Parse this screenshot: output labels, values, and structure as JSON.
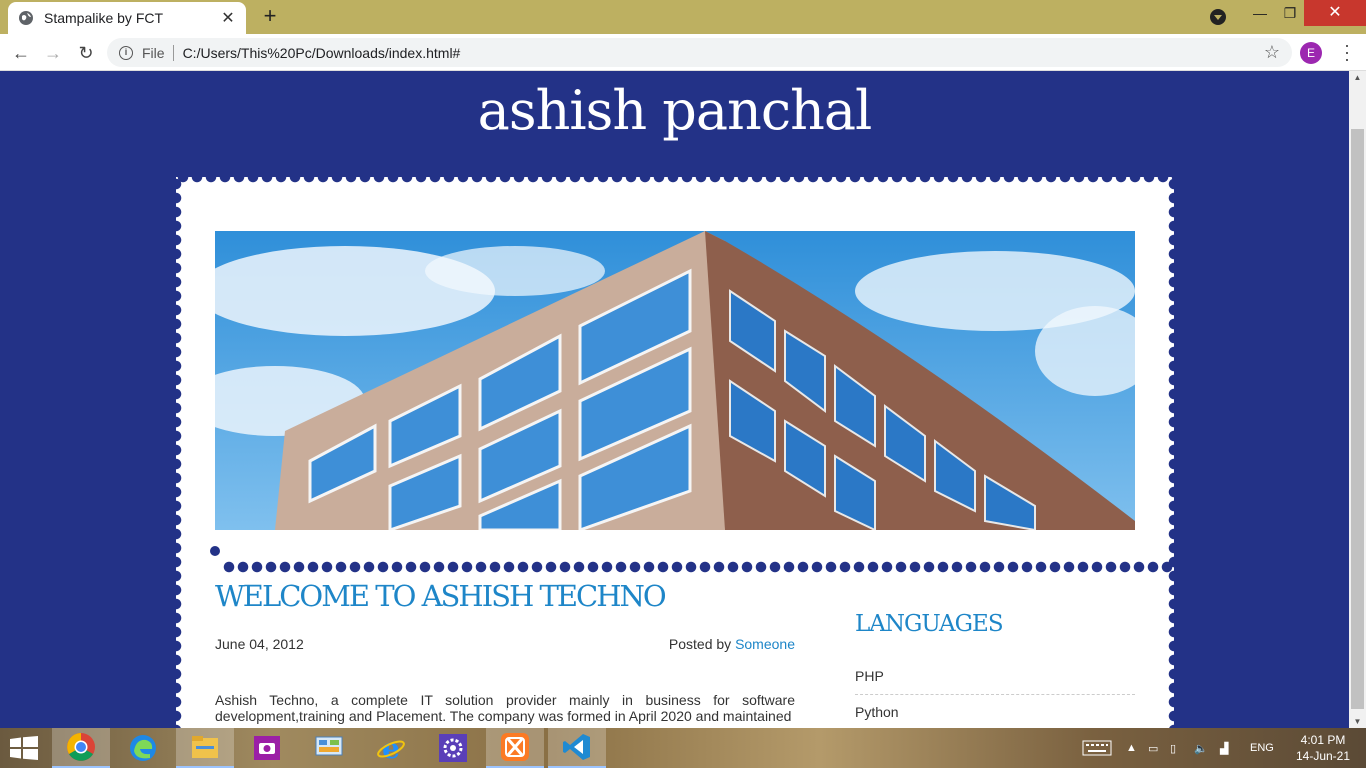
{
  "browser": {
    "tab_title": "Stampalike by FCT",
    "tab_close": "✕",
    "new_tab": "+",
    "file_label": "File",
    "url": "C:/Users/This%20Pc/Downloads/index.html#",
    "profile_initial": "E"
  },
  "window_controls": {
    "minimize": "—",
    "maximize": "❐",
    "close": "✕"
  },
  "site": {
    "title": "ashish panchal",
    "post": {
      "title": "WELCOME TO ASHISH TECHNO",
      "date": "June 04, 2012",
      "posted_by_label": "Posted by",
      "author": "Someone",
      "body": "Ashish Techno, a complete IT solution provider mainly in business for software development,training and Placement. The company was formed in April 2020 and maintained"
    },
    "sidebar": {
      "title": "LANGUAGES",
      "items": [
        {
          "label": "PHP"
        },
        {
          "label": "Python"
        }
      ]
    }
  },
  "taskbar": {
    "lang": "ENG",
    "time": "4:01 PM",
    "date": "14-Jun-21",
    "apps": [
      {
        "name": "chrome",
        "icon": "chrome-icon"
      },
      {
        "name": "edge",
        "icon": "edge-icon"
      },
      {
        "name": "file-explorer",
        "icon": "folder-icon"
      },
      {
        "name": "camera",
        "icon": "camera-icon"
      },
      {
        "name": "control-panel",
        "icon": "control-panel-icon"
      },
      {
        "name": "internet-explorer",
        "icon": "ie-icon"
      },
      {
        "name": "settings",
        "icon": "gear-icon"
      },
      {
        "name": "xampp",
        "icon": "xampp-icon"
      },
      {
        "name": "vscode",
        "icon": "vscode-icon"
      }
    ]
  },
  "colors": {
    "page_background": "#233287",
    "accent": "#1e86c8",
    "tab_strip": "#bdb061",
    "close_button": "#c8372d"
  }
}
